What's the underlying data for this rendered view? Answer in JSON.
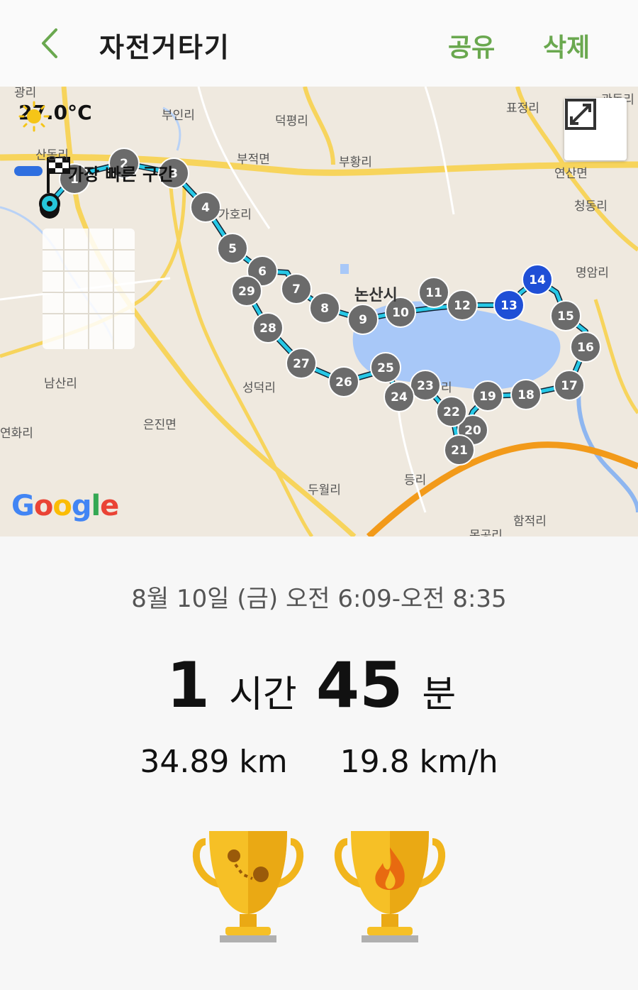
{
  "header": {
    "title": "자전거타기",
    "share_label": "공유",
    "delete_label": "삭제"
  },
  "map": {
    "weather_temp": "27.0°C",
    "fastest_section_label": "가장 빠른 구간",
    "attribution": "Google",
    "places": {
      "gwangri": "광리",
      "buinri": "부인리",
      "deokpyeongri": "덕평리",
      "pyojeongri": "표정리",
      "gwandongri": "관동리",
      "sandongri": "산동리",
      "bujeokmyeon": "부적면",
      "buhwangri": "부황리",
      "yeonsanmyeon": "연산면",
      "cheongdongri": "청동리",
      "gahori": "가호리",
      "nonsansi": "논산시",
      "myeongamri": "명암리",
      "namsanri": "남산리",
      "seongdeokri": "성덕리",
      "eunjinmyeon": "은진면",
      "yeonhwari": "연화리",
      "duwolri": "두월리",
      "deungri": "등리",
      "hamjeokri": "함적리",
      "mokgongri": "목공리",
      "ri": "리"
    },
    "markers": [
      "1",
      "2",
      "3",
      "4",
      "5",
      "6",
      "7",
      "8",
      "9",
      "10",
      "11",
      "12",
      "13",
      "14",
      "15",
      "16",
      "17",
      "18",
      "19",
      "20",
      "21",
      "22",
      "23",
      "24",
      "25",
      "26",
      "27",
      "28",
      "29"
    ],
    "highlighted_markers": [
      "13",
      "14"
    ],
    "colors": {
      "route": "#27c8e6",
      "marker_gray": "#6b6b6b",
      "marker_blue": "#1f4fd6",
      "water": "#a8c8f8",
      "highway": "#f29a1a",
      "main_road": "#f7d45c"
    }
  },
  "activity": {
    "date_range": "8월 10일 (금) 오전 6:09-오전 8:35",
    "hours": "1",
    "hours_unit": "시간",
    "minutes": "45",
    "minutes_unit": "분",
    "distance": "34.89 km",
    "avg_speed": "19.8 km/h"
  },
  "trophies": [
    {
      "icon": "route-pin-trophy-icon"
    },
    {
      "icon": "flame-trophy-icon"
    }
  ],
  "accent_color": "#6aa84f"
}
